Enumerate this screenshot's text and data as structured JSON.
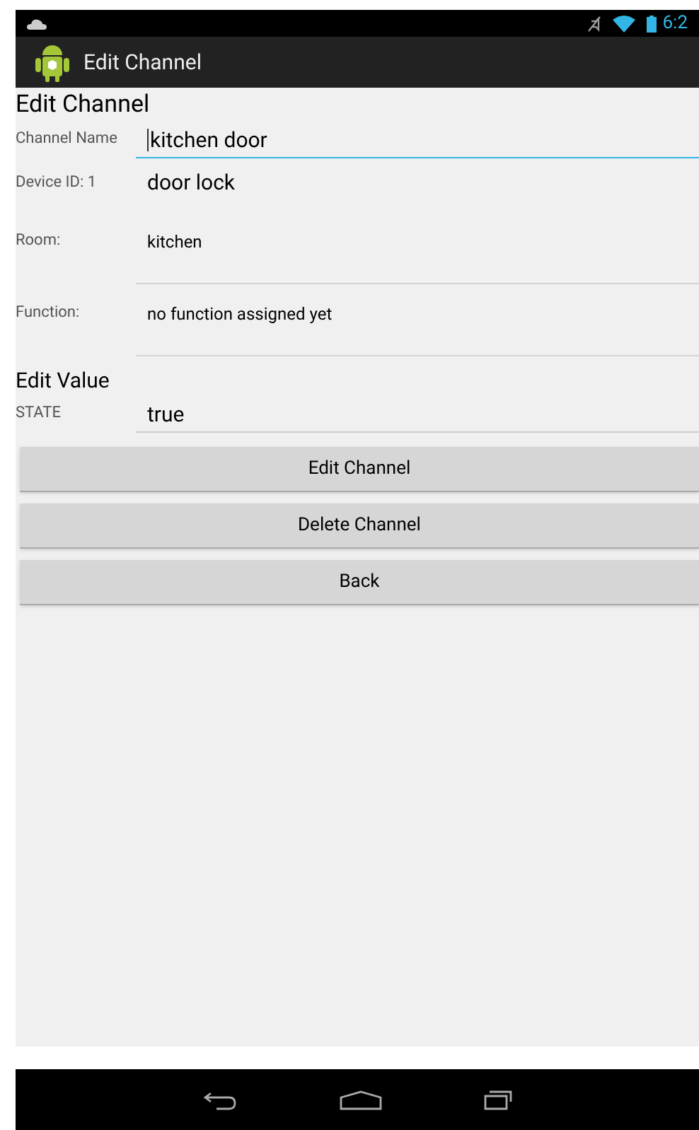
{
  "status_bar": {
    "time": "6:2"
  },
  "action_bar": {
    "title": "Edit Channel"
  },
  "heading": "Edit Channel",
  "fields": [
    {
      "label": "Channel Name",
      "value": "kitchen door",
      "kind": "input",
      "focused": true
    },
    {
      "label": "Device ID: 1",
      "value": "door lock",
      "kind": "text"
    },
    {
      "label": "Room:",
      "value": "kitchen",
      "kind": "underlined"
    },
    {
      "label": "Function:",
      "value": "no function assigned yet",
      "kind": "underlined"
    }
  ],
  "value_heading": "Edit Value",
  "value_field": {
    "label": "STATE",
    "value": "true",
    "kind": "input",
    "focused": false
  },
  "buttons": [
    "Edit Channel",
    "Delete Channel",
    "Back"
  ]
}
